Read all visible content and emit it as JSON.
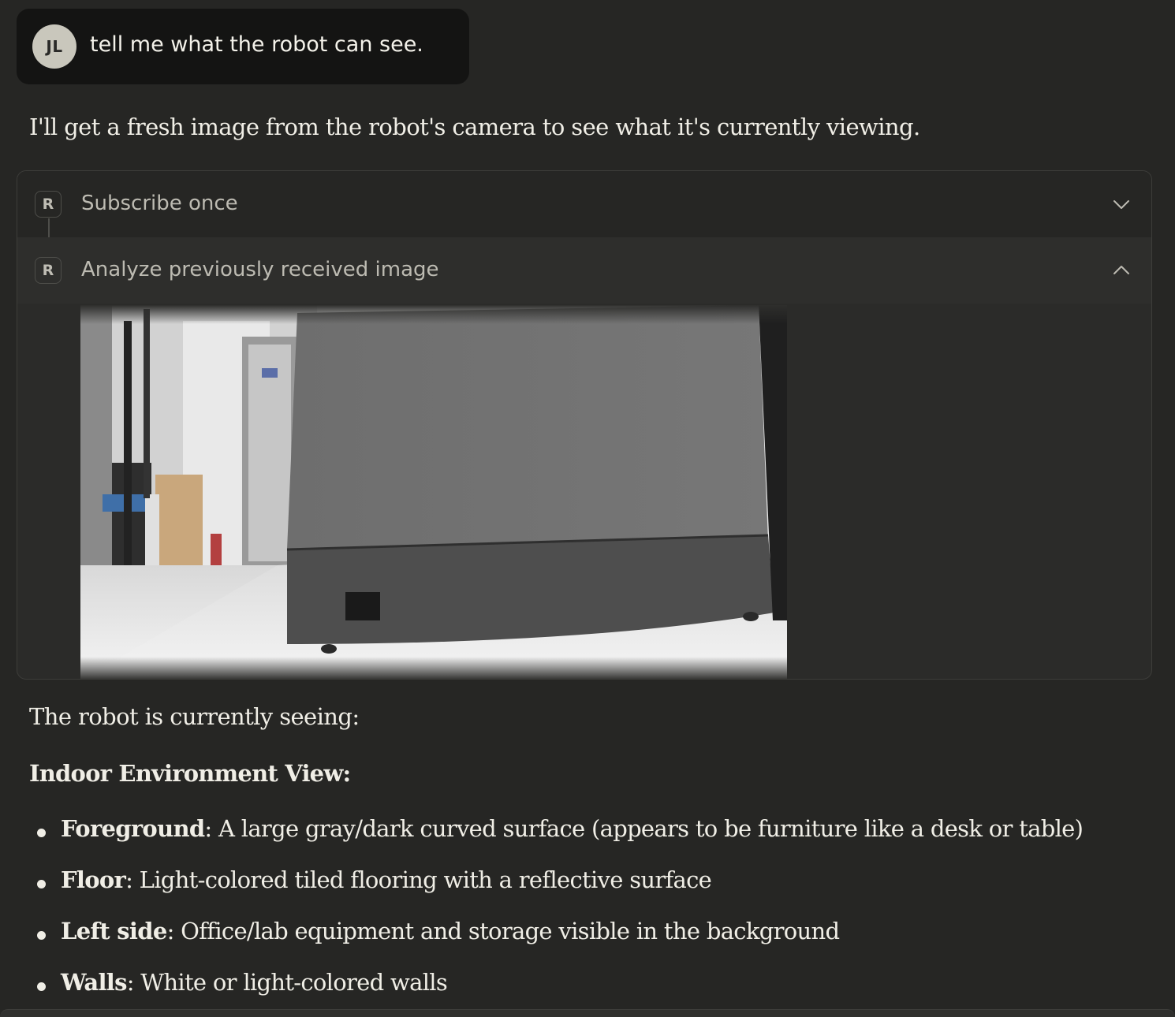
{
  "user_message": {
    "avatar_initials": "JL",
    "text": "tell me what the robot can see."
  },
  "assistant": {
    "intro": "I'll get a fresh image from the robot's camera to see what it's currently viewing.",
    "tool_calls": [
      {
        "icon_letter": "R",
        "label": "Subscribe once",
        "expanded": false
      },
      {
        "icon_letter": "R",
        "label": "Analyze previously received image",
        "expanded": true
      }
    ],
    "summary_intro": "The robot is currently seeing:",
    "heading": "Indoor Environment View:",
    "bullets": [
      {
        "term": "Foreground",
        "text": ": A large gray/dark curved surface (appears to be furniture like a desk or table)"
      },
      {
        "term": "Floor",
        "text": ": Light-colored tiled flooring with a reflective surface"
      },
      {
        "term": "Left side",
        "text": ": Office/lab equipment and storage visible in the background"
      },
      {
        "term": "Walls",
        "text": ": White or light-colored walls"
      }
    ]
  },
  "colors": {
    "background": "#262624",
    "user_bubble": "#141413",
    "avatar": "#c9c7bc",
    "text": "#f0eee6",
    "tool_border": "#3d3d3a"
  }
}
